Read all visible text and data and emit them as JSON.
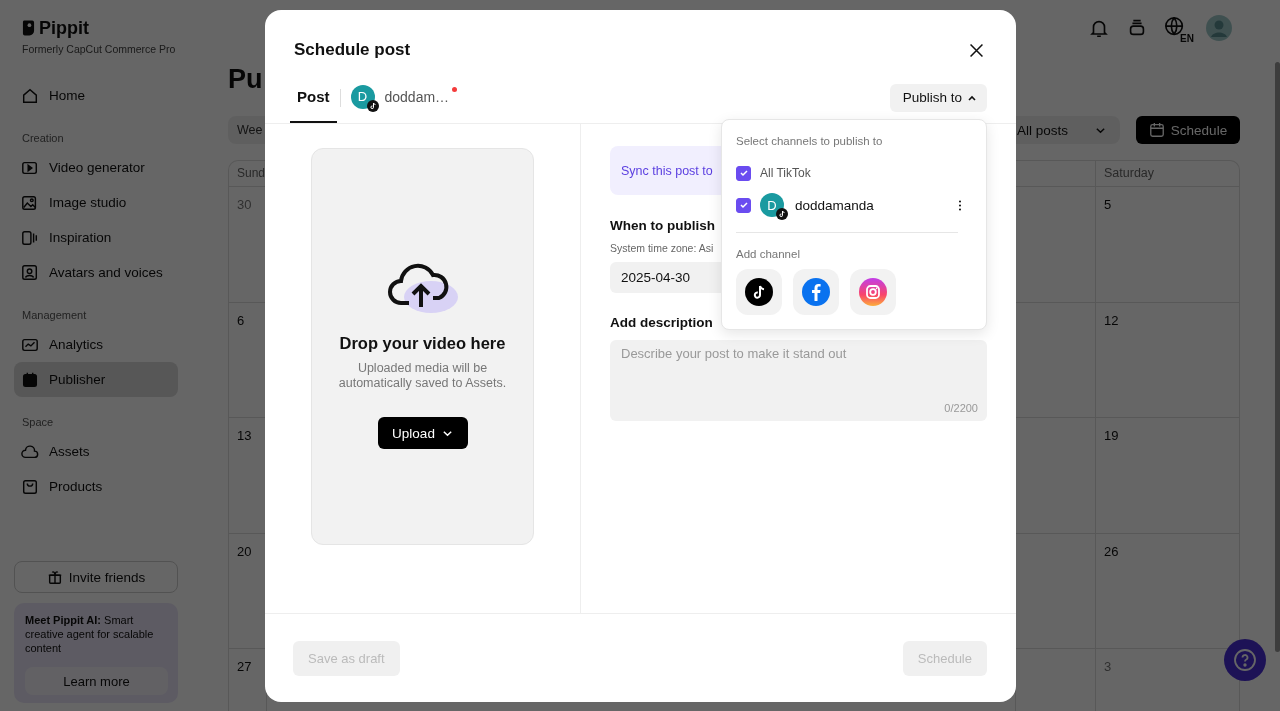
{
  "sidebar": {
    "brand": "Pippit",
    "tagline": "Formerly CapCut Commerce Pro",
    "sections": [
      {
        "items": [
          {
            "kind": "home",
            "label": "Home",
            "selected": false
          }
        ]
      },
      {
        "heading": "Creation",
        "items": [
          {
            "kind": "video",
            "label": "Video generator",
            "selected": false
          },
          {
            "kind": "image",
            "label": "Image studio",
            "selected": false
          },
          {
            "kind": "inspiration",
            "label": "Inspiration",
            "selected": false
          },
          {
            "kind": "avatar",
            "label": "Avatars and voices",
            "selected": false
          }
        ]
      },
      {
        "heading": "Management",
        "items": [
          {
            "kind": "analytics",
            "label": "Analytics",
            "selected": false
          },
          {
            "kind": "publisher",
            "label": "Publisher",
            "selected": true
          }
        ]
      },
      {
        "heading": "Space",
        "items": [
          {
            "kind": "assets",
            "label": "Assets",
            "selected": false
          },
          {
            "kind": "products",
            "label": "Products",
            "selected": false
          }
        ]
      }
    ],
    "invite_button": "Invite friends",
    "promo": {
      "text": "**Meet Pippit AI:** Smart creative agent for scalable content",
      "button": "Learn more"
    }
  },
  "top_bar": {
    "language": "EN"
  },
  "page": {
    "title": "Pu",
    "view_button": "Wee",
    "filter": "All posts",
    "schedule_button": "Schedule"
  },
  "calendar": {
    "sunday_column": {
      "heading": "Sund",
      "dates": [
        {
          "label": "30",
          "other_month": true
        },
        {
          "label": "6",
          "other_month": false
        },
        {
          "label": "13",
          "other_month": false
        },
        {
          "label": "20",
          "other_month": false
        },
        {
          "label": "27",
          "other_month": false
        }
      ]
    },
    "saturday_column": {
      "heading": "Saturday",
      "dates": [
        {
          "label": "5",
          "other_month": false
        },
        {
          "label": "12",
          "other_month": false
        },
        {
          "label": "19",
          "other_month": false
        },
        {
          "label": "26",
          "other_month": false
        },
        {
          "label": "3",
          "other_month": true
        }
      ]
    }
  },
  "modal": {
    "title": "Schedule post",
    "tabs": [
      {
        "kind": "post",
        "label": "Post",
        "selected": true
      },
      {
        "kind": "account",
        "label": "doddam…",
        "avatar": "D",
        "notification_dot": true,
        "selected": false
      }
    ],
    "publish_button": {
      "label": "Publish to",
      "expanded": true
    },
    "upload": {
      "title": "Drop your video here",
      "subtitle": "Uploaded media will be automatically saved to Assets.",
      "button": "Upload"
    },
    "sync_text": "Sync this post to",
    "when": {
      "label": "When to publish",
      "timezone": "System time zone: Asi",
      "date": "2025-04-30"
    },
    "description": {
      "label": "Add description",
      "placeholder": "Describe your post to make it stand out",
      "counter": "0/2200"
    },
    "footer": {
      "draft": {
        "label": "Save as draft",
        "disabled": true
      },
      "schedule": {
        "label": "Schedule",
        "disabled": true
      }
    },
    "dropdown": {
      "title": "Select channels to publish to",
      "channels": [
        {
          "kind": "group",
          "label": "All TikTok",
          "checked": true
        },
        {
          "kind": "account",
          "label": "doddamanda",
          "avatar": "D",
          "checked": true
        }
      ],
      "add_label": "Add channel",
      "add_channels": [
        {
          "kind": "tiktok"
        },
        {
          "kind": "facebook"
        },
        {
          "kind": "instagram"
        }
      ]
    }
  }
}
